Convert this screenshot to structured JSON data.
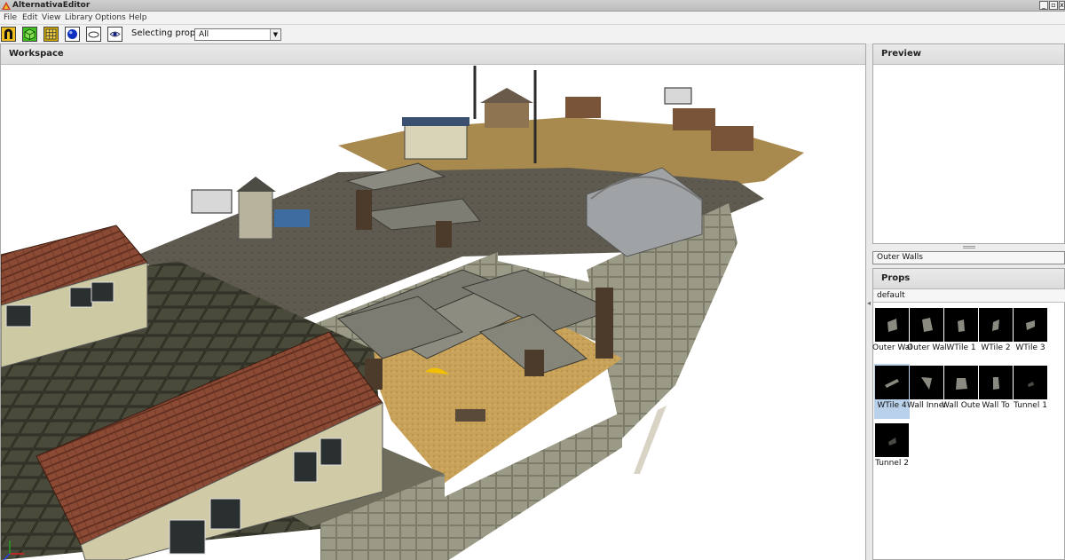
{
  "window": {
    "title": "AlternativaEditor",
    "controls": {
      "minimize": "_",
      "maximize": "▫",
      "close": "x"
    }
  },
  "menu": [
    "File",
    "Edit",
    "View",
    "Library",
    "Options",
    "Help"
  ],
  "toolbar": {
    "tools": [
      {
        "name": "magnet-tool",
        "icon": "magnet-icon",
        "bg": "#f0c020"
      },
      {
        "name": "box-tool",
        "icon": "cube-icon",
        "bg": "#40c020"
      },
      {
        "name": "grid-tool",
        "icon": "grid-icon",
        "bg": "#d8b000"
      },
      {
        "name": "sphere-tool",
        "icon": "sphere-icon",
        "bg": "#ffffff"
      },
      {
        "name": "plane-tool",
        "icon": "ellipse-icon",
        "bg": "#ffffff"
      },
      {
        "name": "view-tool",
        "icon": "eye-icon",
        "bg": "#ffffff"
      }
    ],
    "selecting_prop_label": "Selecting prop:",
    "selecting_prop_value": "All"
  },
  "workspace": {
    "title": "Workspace"
  },
  "preview": {
    "title": "Preview"
  },
  "library_select": "Outer Walls",
  "props_panel": {
    "title": "Props",
    "group": "default",
    "items": [
      {
        "label": "Outer Wall",
        "selected": false
      },
      {
        "label": "Outer Wall",
        "selected": false
      },
      {
        "label": "WTile 1",
        "selected": false
      },
      {
        "label": "WTile 2",
        "selected": false
      },
      {
        "label": "WTile 3",
        "selected": false
      },
      {
        "label": "WTile 4",
        "selected": true
      },
      {
        "label": "Wall Inner",
        "selected": false
      },
      {
        "label": "Wall Outer",
        "selected": false
      },
      {
        "label": "Wall To",
        "selected": false
      },
      {
        "label": "Tunnel 1",
        "selected": false
      },
      {
        "label": "Tunnel 2",
        "selected": false
      }
    ]
  },
  "colors": {
    "selection": "#b9d1ea",
    "panel_header": "#dcdcdc",
    "sand": "#c8a050",
    "stone": "#8a8a78",
    "roof": "#7a3a2a"
  }
}
